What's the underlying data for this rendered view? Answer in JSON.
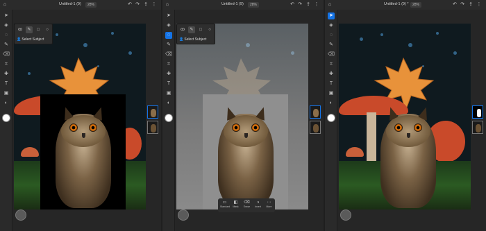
{
  "doc_title": "Untitled-1 (9)",
  "zoom": "28%",
  "panel3_title": "Untitled-1 (9) *",
  "selection_popover": {
    "action_label": "Select Subject"
  },
  "bottom_bar": {
    "items": [
      "Standard",
      "Mask",
      "Erase",
      "Invert",
      "More"
    ]
  },
  "colors": {
    "accent": "#1473e6",
    "app_bg": "#262626",
    "owl_eye": "#e07a10",
    "mushroom_red": "#c94a2a",
    "maple_orange": "#e8923a"
  },
  "icons": {
    "toolbar": [
      "move-icon",
      "layers-icon",
      "lasso-icon",
      "brush-icon",
      "eraser-icon",
      "crop-icon",
      "heal-icon",
      "text-icon",
      "image-icon",
      "fill-icon",
      "swatch-icon"
    ],
    "popover": [
      "lasso-icon",
      "brush-select-icon",
      "rect-select-icon",
      "ellipse-select-icon"
    ]
  }
}
